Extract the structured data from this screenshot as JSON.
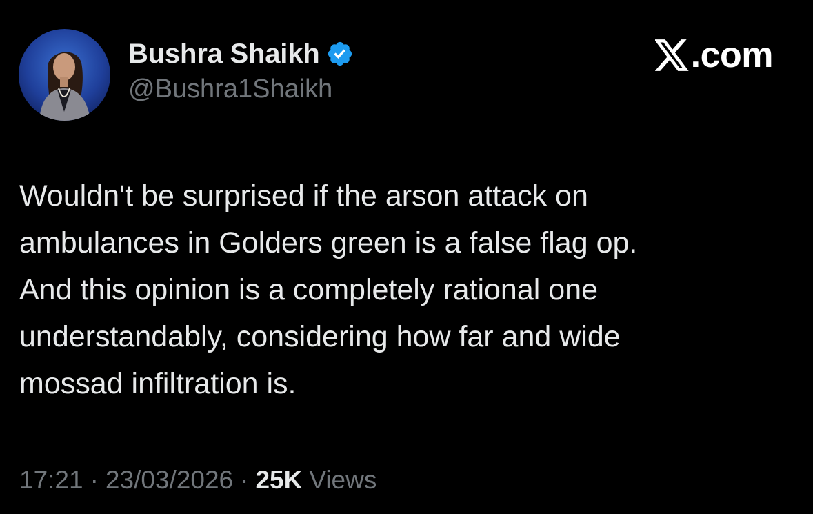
{
  "colors": {
    "background": "#000000",
    "text_primary": "#e7e9ea",
    "text_secondary": "#71767b",
    "verified_blue": "#1d9bf0",
    "brand": "#ffffff"
  },
  "author": {
    "display_name": "Bushra Shaikh",
    "handle": "@Bushra1Shaikh",
    "verified_icon": "verified-badge-icon",
    "avatar_icon": "profile-photo"
  },
  "brand": {
    "logo_icon": "x-logo-icon",
    "text": ".com"
  },
  "tweet": {
    "lines": [
      "Wouldn't be surprised if the arson attack on",
      "ambulances in Golders green is a false flag op.",
      "And this opinion is a completely rational one",
      "understandably, considering how far and wide",
      "mossad infiltration is."
    ]
  },
  "meta": {
    "time": "17:21",
    "separator": "·",
    "date": "23/03/2026",
    "views_count": "25K",
    "views_label": "Views"
  }
}
